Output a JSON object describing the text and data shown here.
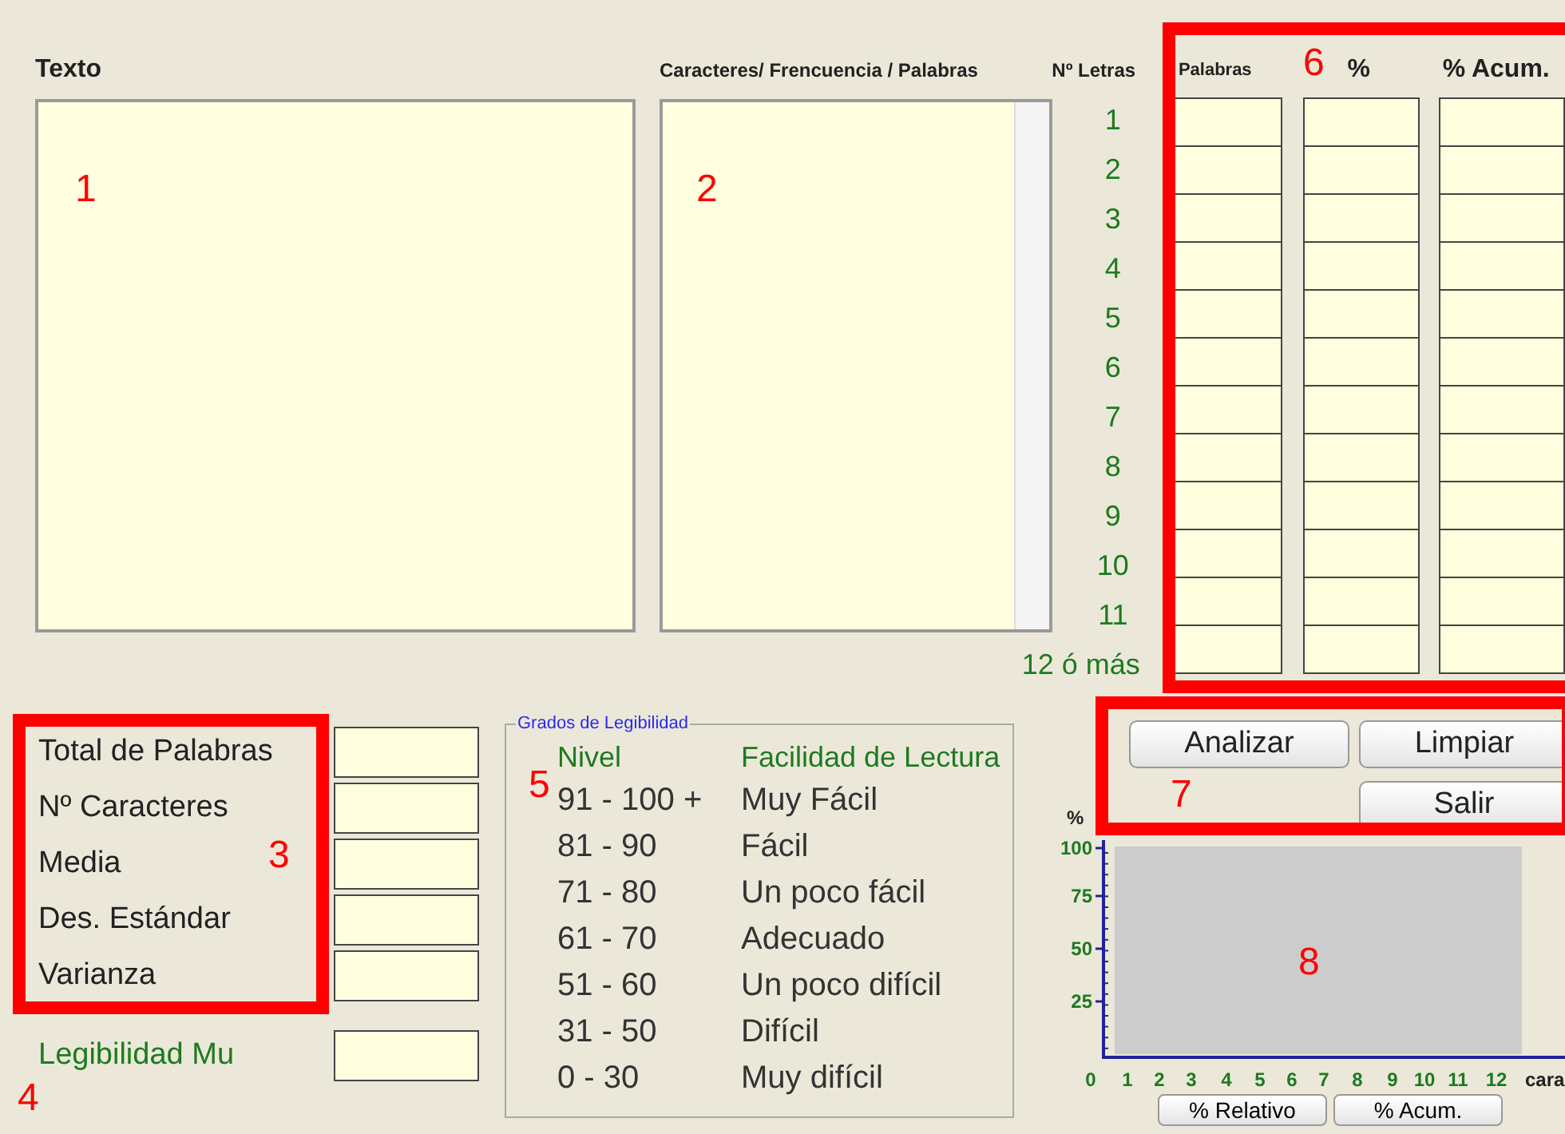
{
  "text_panel": {
    "title": "Texto"
  },
  "chars_panel": {
    "title": "Caracteres/ Frencuencia / Palabras"
  },
  "letters_table": {
    "row_header": "Nº Letras",
    "columns": [
      "Palabras",
      "%",
      "% Acum."
    ],
    "rows": [
      {
        "letters": "1"
      },
      {
        "letters": "2"
      },
      {
        "letters": "3"
      },
      {
        "letters": "4"
      },
      {
        "letters": "5"
      },
      {
        "letters": "6"
      },
      {
        "letters": "7"
      },
      {
        "letters": "8"
      },
      {
        "letters": "9"
      },
      {
        "letters": "10"
      },
      {
        "letters": "11"
      },
      {
        "letters": "12 ó más"
      }
    ]
  },
  "stats": [
    {
      "label": "Total de Palabras"
    },
    {
      "label": "Nº Caracteres"
    },
    {
      "label": "Media"
    },
    {
      "label": "Des. Estándar"
    },
    {
      "label": "Varianza"
    }
  ],
  "legibility": {
    "label": "Legibilidad Mu"
  },
  "legibility_grades": {
    "title": "Grados de Legibilidad",
    "headers": [
      "Nivel",
      "Facilidad de Lectura"
    ],
    "rows": [
      {
        "level": "91 - 100 +",
        "ease": "Muy Fácil"
      },
      {
        "level": "81 - 90",
        "ease": "Fácil"
      },
      {
        "level": "71 - 80",
        "ease": "Un poco fácil"
      },
      {
        "level": "61 - 70",
        "ease": "Adecuado"
      },
      {
        "level": "51 - 60",
        "ease": "Un poco difícil"
      },
      {
        "level": "31 - 50",
        "ease": "Difícil"
      },
      {
        "level": "0 - 30",
        "ease": "Muy difícil"
      }
    ]
  },
  "buttons": {
    "analyze": "Analizar",
    "clear": "Limpiar",
    "exit": "Salir"
  },
  "chart": {
    "unit": "%",
    "yticks": [
      "100",
      "75",
      "50",
      "25"
    ],
    "xticks": [
      "0",
      "1",
      "2",
      "3",
      "4",
      "5",
      "6",
      "7",
      "8",
      "9",
      "10",
      "11",
      "12"
    ],
    "xlabel": "cara",
    "toggles": [
      "% Relativo",
      "% Acum."
    ]
  },
  "annotations": [
    {
      "label": "1",
      "boxed": false
    },
    {
      "label": "2",
      "boxed": false
    },
    {
      "label": "3",
      "boxed": true
    },
    {
      "label": "4",
      "boxed": false
    },
    {
      "label": "5",
      "boxed": false
    },
    {
      "label": "6",
      "boxed": true
    },
    {
      "label": "7",
      "boxed": true
    },
    {
      "label": "8",
      "boxed": false
    }
  ]
}
